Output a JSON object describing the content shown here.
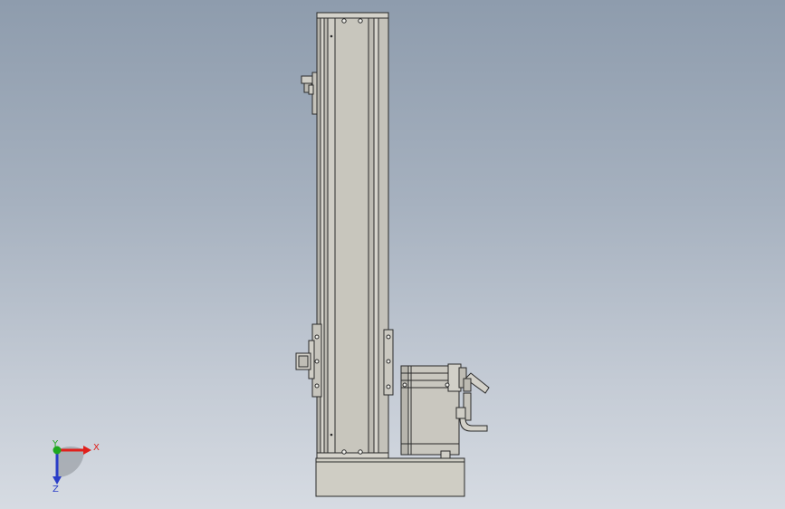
{
  "viewport": {
    "background_top": "#8e9cad",
    "background_bottom": "#d6dbe2"
  },
  "model": {
    "icon": "linear-actuator-with-servo-motor",
    "colors": {
      "body_fill": "#c8c6bd",
      "body_dark": "#a9a79f",
      "outline": "#2a2a2a",
      "base_fill": "#cfcdc4",
      "motor_fill": "#c9c7bf"
    }
  },
  "triad": {
    "x_label": "X",
    "y_label": "Y",
    "z_label": "Z",
    "x_color": "#e0201c",
    "y_color": "#1ea81e",
    "z_color": "#2a3ec8"
  }
}
